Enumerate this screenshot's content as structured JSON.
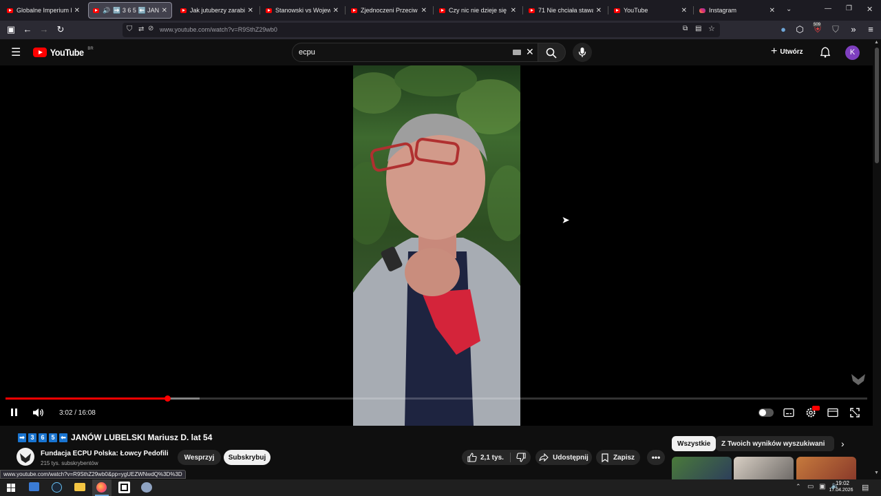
{
  "browser": {
    "tabs": [
      {
        "label": "Globalne Imperium Bezk",
        "icon": "youtube"
      },
      {
        "label": "➡️ 3 6 5 ⬅️ JANÓ",
        "icon": "youtube",
        "active": true,
        "audio": true
      },
      {
        "label": "Jak jutuberzy zarabiają n",
        "icon": "youtube"
      },
      {
        "label": "Stanowski vs Wojewódzk",
        "icon": "youtube"
      },
      {
        "label": "Zjednoczeni Przeciw Ras",
        "icon": "youtube"
      },
      {
        "label": "Czy nic nie dzieje się prz",
        "icon": "youtube"
      },
      {
        "label": "71 Nie chciała stawać (M",
        "icon": "youtube"
      },
      {
        "label": "YouTube",
        "icon": "youtube"
      },
      {
        "label": "Instagram",
        "icon": "instagram"
      }
    ],
    "url": "www.youtube.com/watch?v=R9SthZ29wb0",
    "notification_badge": "509",
    "status_url": "www.youtube.com/watch?v=R9SthZ29wb0&pp=ygUEZWNwdQ%3D%3D"
  },
  "youtube": {
    "logo_text": "YouTube",
    "country": "BR",
    "search_value": "ecpu",
    "create_label": "Utwórz",
    "avatar_letter": "K"
  },
  "player": {
    "time_current": "3:02",
    "time_total": "16:08",
    "time_display": "3:02 / 16:08",
    "played_fraction": 0.188,
    "buffered_fraction": 0.225
  },
  "video": {
    "title": "JANÓW LUBELSKI Mariusz D. lat 54",
    "title_prefix_boxes": [
      "3",
      "6",
      "5"
    ],
    "channel_name": "Fundacja ECPU Polska: Łowcy Pedofili",
    "subscribers": "215 tys. subskrybentów",
    "support_label": "Wesprzyj",
    "subscribe_label": "Subskrybuj",
    "likes": "2,1 tys.",
    "share_label": "Udostępnij",
    "save_label": "Zapisz"
  },
  "chips": [
    "Wszystkie",
    "Z Twoich wyników wyszukiwania"
  ],
  "taskbar": {
    "time": "19:02",
    "date": "17.04.2026"
  },
  "colors": {
    "accent": "#ff0000",
    "avatar": "#7e3fbf",
    "box_blue": "#1a75d1"
  }
}
